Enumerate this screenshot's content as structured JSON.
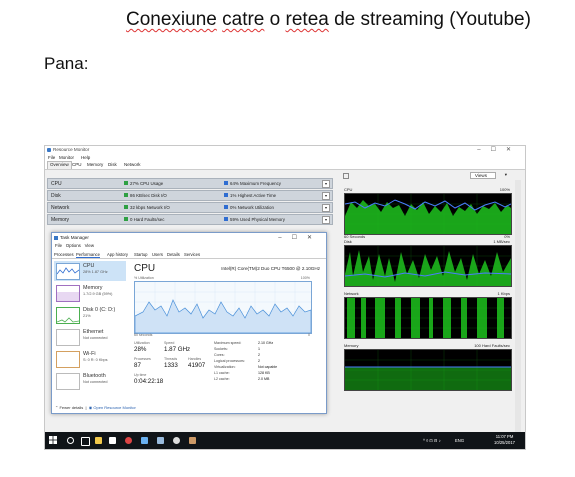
{
  "document": {
    "title_words": [
      {
        "text": "Conexiune",
        "flag": true
      },
      {
        "text": "catre",
        "flag": true
      },
      {
        "text": "o",
        "flag": false
      },
      {
        "text": "retea",
        "flag": true
      },
      {
        "text": "de",
        "flag": false
      },
      {
        "text": "streaming",
        "flag": false
      },
      {
        "text": "(Youtube)",
        "flag": false
      }
    ],
    "label": "Pana:"
  },
  "resource_monitor": {
    "title": "Resource Monitor",
    "menu": [
      "File",
      "Monitor",
      "Help"
    ],
    "tabs": [
      "Overview",
      "CPU",
      "Memory",
      "Disk",
      "Network"
    ],
    "sections": [
      {
        "name": "CPU",
        "stat1": "27% CPU Usage",
        "stat2": "64% Maximum Frequency"
      },
      {
        "name": "Disk",
        "stat1": "86 KB/sec Disk I/O",
        "stat2": "1% Highest Active Time"
      },
      {
        "name": "Network",
        "stat1": "32 kbps Network I/O",
        "stat2": "0% Network Utilization"
      },
      {
        "name": "Memory",
        "stat1": "0 Hard Faults/sec",
        "stat2": "59% Used Physical Memory"
      }
    ],
    "views_label": "Views",
    "graphs": [
      {
        "name": "CPU",
        "max": "100%",
        "footer_left": "60 Seconds",
        "footer_right": "0%"
      },
      {
        "name": "Disk",
        "max": "1 MB/sec",
        "footer_left": "",
        "footer_right": "0"
      },
      {
        "name": "Network",
        "max": "1 Kbps",
        "footer_left": "",
        "footer_right": "0"
      },
      {
        "name": "Memory",
        "max": "100 Hard Faults/sec",
        "footer_left": "",
        "footer_right": "0"
      }
    ]
  },
  "task_manager": {
    "title": "Task Manager",
    "menu": [
      "File",
      "Options",
      "View"
    ],
    "tabs": [
      "Processes",
      "Performance",
      "App history",
      "Startup",
      "Users",
      "Details",
      "Services"
    ],
    "side_items": [
      {
        "name": "CPU",
        "sub": "28% 1.87 GHz"
      },
      {
        "name": "Memory",
        "sub": "1.7/2.9 GB (59%)"
      },
      {
        "name": "Disk 0 (C: D:)",
        "sub": "21%"
      },
      {
        "name": "Ethernet",
        "sub": "Not connected"
      },
      {
        "name": "Wi-Fi",
        "sub": "S: 0 R: 0 Kbps"
      },
      {
        "name": "Bluetooth",
        "sub": "Not connected"
      }
    ],
    "cpu": {
      "heading": "CPU",
      "processor": "Intel(R) Core(TM)2 Duo CPU T6500 @ 2.10GHz",
      "util_label": "% Utilization",
      "pct_label": "100%",
      "time_label": "60 seconds",
      "zero_label": "0",
      "stats": [
        {
          "label": "Utilization",
          "value": "28%"
        },
        {
          "label": "Speed",
          "value": "1.87 GHz"
        },
        {
          "label": "Processes",
          "value": "87"
        },
        {
          "label": "Threads",
          "value": "1333"
        },
        {
          "label": "Handles",
          "value": "41907"
        }
      ],
      "uptime_label": "Up time",
      "uptime": "0:04:22:18",
      "details": [
        {
          "k": "Maximum speed:",
          "v": "2.10 GHz"
        },
        {
          "k": "Sockets:",
          "v": "1"
        },
        {
          "k": "Cores:",
          "v": "2"
        },
        {
          "k": "Logical processors:",
          "v": "2"
        },
        {
          "k": "Virtualization:",
          "v": "Not capable"
        },
        {
          "k": "L1 cache:",
          "v": "128 KB"
        },
        {
          "k": "L2 cache:",
          "v": "2.0 MB"
        }
      ]
    },
    "footer": {
      "fewer": "Fewer details",
      "open_rm": "Open Resource Monitor"
    }
  },
  "taskbar": {
    "time": "11:07 PM",
    "date": "10/25/2017",
    "lang": "ENG"
  },
  "colors": {
    "accent": "#2f6dd1",
    "graph_green": "#1ec21e",
    "graph_blue": "#4a7dff"
  }
}
